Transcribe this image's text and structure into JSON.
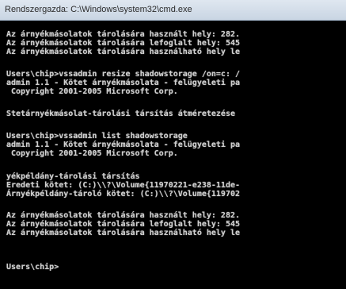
{
  "window": {
    "title": "Rendszergazda: C:\\Windows\\system32\\cmd.exe"
  },
  "console": {
    "lines": [
      "Az árnyékmásolatok tárolására használt hely: 282.",
      "Az árnyékmásolatok tárolására lefoglalt hely: 545",
      "Az árnyékmásolatok tárolására használható hely le",
      "",
      "Users\\chip>vssadmin resize shadowstorage /on=c: /",
      "admin 1.1 - Kötet árnyékmásolata - felügyeleti pa",
      " Copyright 2001-2005 Microsoft Corp.",
      "",
      "Stetárnyékmásolat-tárolási társítás átméretezése",
      "",
      "Users\\chip>vssadmin list shadowstorage",
      "admin 1.1 - Kötet árnyékmásolata - felügyeleti pa",
      " Copyright 2001-2005 Microsoft Corp.",
      "",
      "yékpéldány-tárolási társítás",
      "Eredeti kötet: (C:)\\\\?\\Volume{11970221-e238-11de-",
      "Árnyékpéldány-tároló kötet: (C:)\\\\?\\Volume{119702",
      "",
      "Az árnyékmásolatok tárolására használt hely: 282.",
      "Az árnyékmásolatok tárolására lefoglalt hely: 545",
      "Az árnyékmásolatok tárolására használható hely le",
      "",
      "Users\\chip>"
    ]
  }
}
